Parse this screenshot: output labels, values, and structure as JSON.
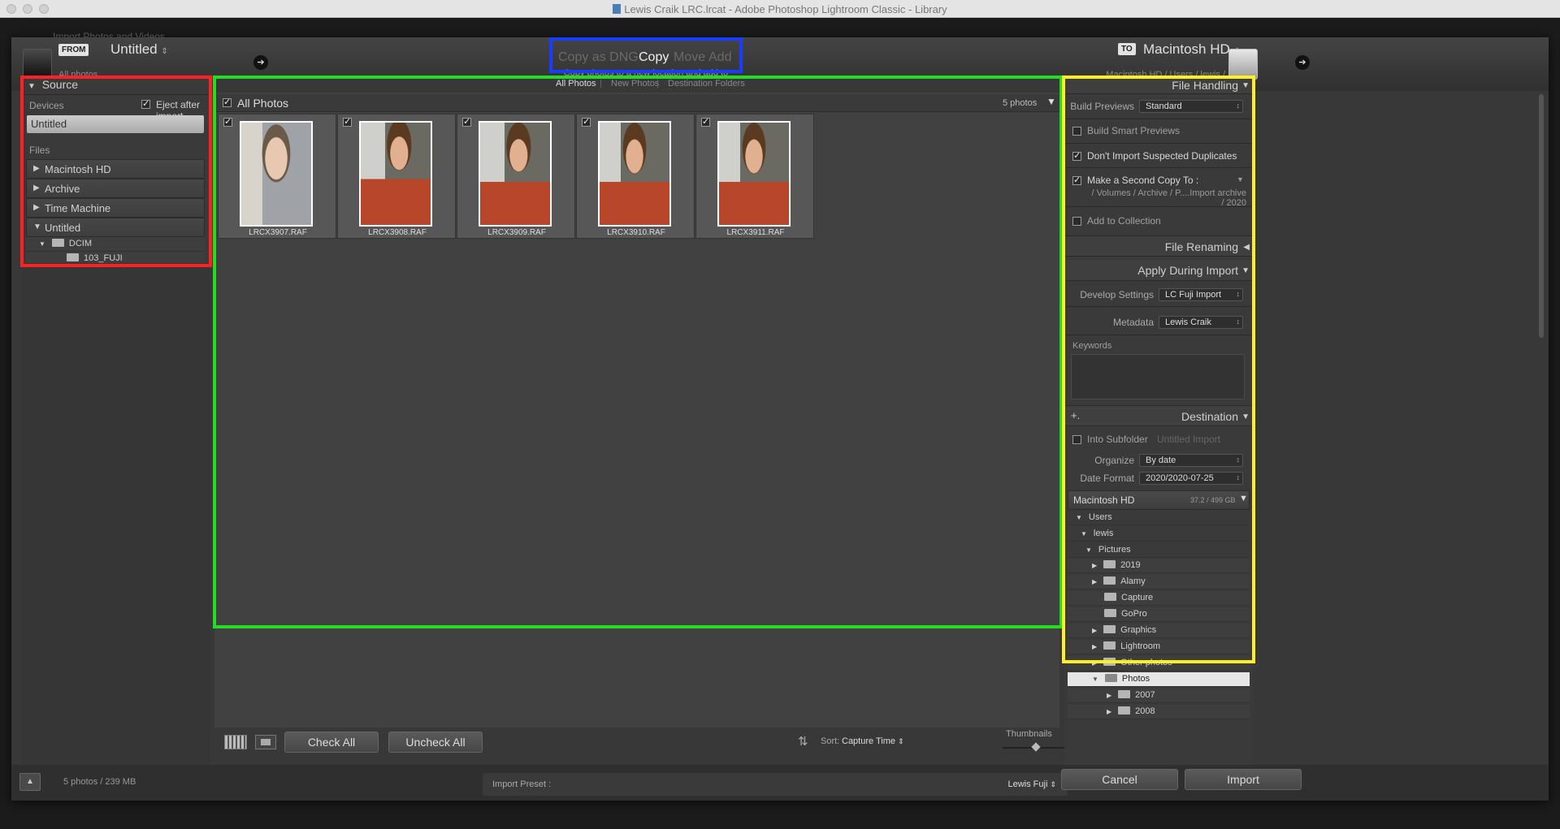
{
  "window": {
    "title": "Lewis Craik LRC.lrcat - Adobe Photoshop Lightroom Classic - Library",
    "underlay_title": "Import Photos and Videos"
  },
  "from": {
    "tag": "FROM",
    "name": "Untitled",
    "sub": "All photos"
  },
  "modes": {
    "copy_dng": "Copy as DNG",
    "copy": "Copy",
    "move": "Move",
    "add": "Add",
    "description": "Copy photos to a new location and add to catalog"
  },
  "to": {
    "tag": "TO",
    "name": "Macintosh HD",
    "path": "Macintosh HD / Users / lewis / Pictures / Photos"
  },
  "source": {
    "title": "Source",
    "devices_label": "Devices",
    "eject_label": "Eject after import",
    "eject_checked": true,
    "device": "Untitled",
    "files_label": "Files",
    "volumes": [
      "Macintosh HD",
      "Archive",
      "Time Machine"
    ],
    "expanded_volume": "Untitled",
    "dcim": "DCIM",
    "subfolder": "103_FUJI"
  },
  "center": {
    "tabs": [
      "All Photos",
      "New Photos",
      "Destination Folders"
    ],
    "all_photos_label": "All Photos",
    "count": "5 photos",
    "photos": [
      {
        "name": "LRCX3907.RAF",
        "checked": true
      },
      {
        "name": "LRCX3908.RAF",
        "checked": true
      },
      {
        "name": "LRCX3909.RAF",
        "checked": true
      },
      {
        "name": "LRCX3910.RAF",
        "checked": true
      },
      {
        "name": "LRCX3911.RAF",
        "checked": true
      }
    ]
  },
  "toolbar": {
    "check_all": "Check All",
    "uncheck_all": "Uncheck All",
    "sort_label": "Sort:",
    "sort_value": "Capture Time",
    "thumbnails_label": "Thumbnails",
    "thumbnail_size": 0.45
  },
  "file_handling": {
    "title": "File Handling",
    "build_previews_label": "Build Previews",
    "build_previews_value": "Standard",
    "smart_previews": "Build Smart Previews",
    "no_duplicates": "Don't Import Suspected Duplicates",
    "second_copy": "Make a Second Copy To :",
    "second_copy_path": "/ Volumes / Archive / P....Import archive / 2020",
    "add_collection": "Add to Collection"
  },
  "file_renaming": {
    "title": "File Renaming"
  },
  "apply_during_import": {
    "title": "Apply During Import",
    "develop_label": "Develop Settings",
    "develop_value": "LC Fuji Import",
    "metadata_label": "Metadata",
    "metadata_value": "Lewis Craik",
    "keywords_label": "Keywords"
  },
  "destination": {
    "title": "Destination",
    "plus": "+.",
    "subfolder_label": "Into Subfolder",
    "subfolder_value": "Untitled Import",
    "organize_label": "Organize",
    "organize_value": "By date",
    "date_format_label": "Date Format",
    "date_format_value": "2020/2020-07-25",
    "volume": "Macintosh HD",
    "volume_space": "37.2 / 499 GB",
    "users": "Users",
    "lewis": "lewis",
    "pictures": "Pictures",
    "folders": [
      "2019",
      "Alamy",
      "Capture",
      "GoPro",
      "Graphics",
      "Lightroom",
      "Other photos"
    ],
    "photos": "Photos",
    "years": [
      "2007",
      "2008"
    ]
  },
  "bottom": {
    "summary": "5 photos / 239 MB",
    "preset_label": "Import Preset :",
    "preset_value": "Lewis Fuji",
    "cancel": "Cancel",
    "import": "Import"
  },
  "colors": {
    "source_highlight": "#ff2020",
    "center_highlight": "#22dd22",
    "modes_highlight": "#1a3cff",
    "right_highlight": "#ffee22"
  }
}
